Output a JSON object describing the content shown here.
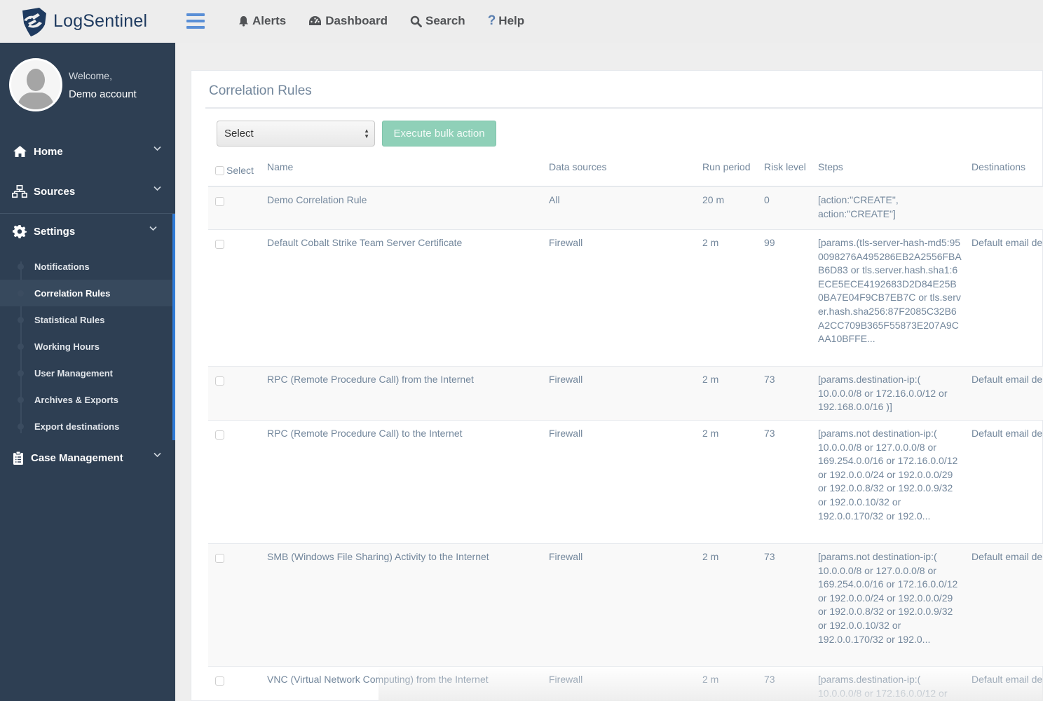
{
  "brand": {
    "name": "LogSentinel",
    "color": "#1e3a5f"
  },
  "topnav": {
    "items": [
      {
        "label": "Alerts",
        "icon": "bell-icon"
      },
      {
        "label": "Dashboard",
        "icon": "dashboard-gauge-icon"
      },
      {
        "label": "Search",
        "icon": "search-icon"
      },
      {
        "label": "Help",
        "icon": "question-icon",
        "glyph": "?"
      }
    ]
  },
  "profile": {
    "greeting": "Welcome,",
    "name": "Demo account"
  },
  "sidebar": {
    "items": [
      {
        "label": "Home",
        "icon": "home-icon"
      },
      {
        "label": "Sources",
        "icon": "sitemap-icon"
      },
      {
        "label": "Settings",
        "icon": "gear-icon"
      },
      {
        "label": "Case Management",
        "icon": "clipboard-icon"
      }
    ],
    "settings_sub": [
      {
        "label": "Notifications"
      },
      {
        "label": "Correlation Rules",
        "active": true
      },
      {
        "label": "Statistical Rules"
      },
      {
        "label": "Working Hours"
      },
      {
        "label": "User Management"
      },
      {
        "label": "Archives & Exports"
      },
      {
        "label": "Export destinations"
      }
    ],
    "accent_color": "#2f7ad6",
    "bg_color": "#2e3f53"
  },
  "page": {
    "title": "Correlation Rules",
    "bulk_select_value": "Select",
    "bulk_button_label": "Execute bulk action"
  },
  "table": {
    "columns": [
      "Select",
      "Name",
      "Data sources",
      "Run period",
      "Risk level",
      "Steps",
      "Destinations"
    ],
    "rows": [
      {
        "name": "Demo Correlation Rule",
        "source": "All",
        "run": "20 m",
        "risk": "0",
        "steps": "[action:\"CREATE\", action:\"CREATE\"]",
        "dest": ""
      },
      {
        "name": "Default Cobalt Strike Team Server Certificate",
        "source": "Firewall",
        "run": "2 m",
        "risk": "99",
        "steps": "[params.(tls-server-hash-md5:950098276A495286EB2A2556FBAB6D83 or tls.server.hash.sha1:6ECE5ECE4192683D2D84E25B0BA7E04F9CB7EB7C or tls.server.hash.sha256:87F2085C32B6A2CC709B365F55873E207A9CAA10BFFE...",
        "dest": "Default email de"
      },
      {
        "name": "RPC (Remote Procedure Call) from the Internet",
        "source": "Firewall",
        "run": "2 m",
        "risk": "73",
        "steps": "[params.destination-ip:( 10.0.0.0/8 or 172.16.0.0/12 or 192.168.0.0/16 )]",
        "dest": "Default email de"
      },
      {
        "name": "RPC (Remote Procedure Call) to the Internet",
        "source": "Firewall",
        "run": "2 m",
        "risk": "73",
        "steps": "[params.not destination-ip:( 10.0.0.0/8 or 127.0.0.0/8 or 169.254.0.0/16 or 172.16.0.0/12 or 192.0.0.0/24 or 192.0.0.0/29 or 192.0.0.8/32 or 192.0.0.9/32 or 192.0.0.10/32 or 192.0.0.170/32 or 192.0...",
        "dest": "Default email de"
      },
      {
        "name": "SMB (Windows File Sharing) Activity to the Internet",
        "source": "Firewall",
        "run": "2 m",
        "risk": "73",
        "steps": "[params.not destination-ip:( 10.0.0.0/8 or 127.0.0.0/8 or 169.254.0.0/16 or 172.16.0.0/12 or 192.0.0.0/24 or 192.0.0.0/29 or 192.0.0.8/32 or 192.0.0.9/32 or 192.0.0.10/32 or 192.0.0.170/32 or 192.0...",
        "dest": "Default email de"
      },
      {
        "name": "VNC (Virtual Network Computing) from the Internet",
        "source": "Firewall",
        "run": "2 m",
        "risk": "73",
        "steps": "[params.destination-ip:( 10.0.0.0/8 or 172.16.0.0/12 or",
        "dest": "Default email de"
      }
    ]
  }
}
